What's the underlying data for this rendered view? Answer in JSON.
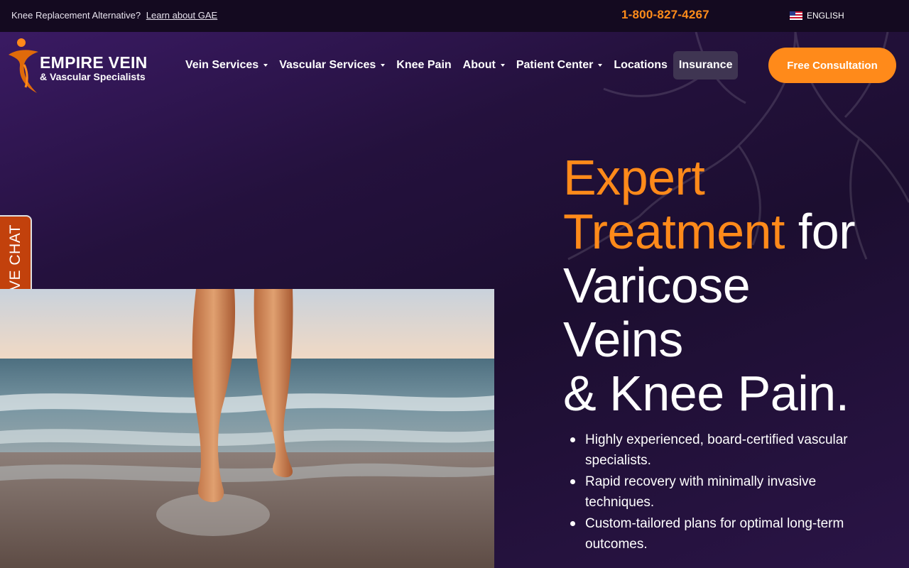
{
  "topbar": {
    "announce_text": "Knee Replacement Alternative?",
    "announce_link": "Learn about GAE",
    "phone": "1-800-827-4267",
    "language": "ENGLISH"
  },
  "logo": {
    "main": "EMPIRE VEIN",
    "sub": "& Vascular Specialists"
  },
  "nav": {
    "items": [
      {
        "label": "Vein Services",
        "dropdown": true
      },
      {
        "label": "Vascular Services",
        "dropdown": true
      },
      {
        "label": "Knee Pain",
        "dropdown": false
      },
      {
        "label": "About",
        "dropdown": true
      },
      {
        "label": "Patient Center",
        "dropdown": true
      },
      {
        "label": "Locations",
        "dropdown": false
      },
      {
        "label": "Insurance",
        "dropdown": false
      }
    ],
    "cta": "Free Consultation"
  },
  "livechat": {
    "label": "LIVE CHAT"
  },
  "hero": {
    "line1_orange": "Expert",
    "line2_orange": "Treatment",
    "line2_white": " for",
    "line3": "Varicose",
    "line4": "Veins",
    "line5": "& Knee Pain.",
    "bullets": [
      "Highly experienced, board-certified vascular specialists.",
      "Rapid recovery with minimally invasive techniques.",
      "Custom-tailored plans for optimal long-term outcomes."
    ]
  },
  "colors": {
    "accent": "#ff8a1a",
    "background": "#1d0f33",
    "livechat": "#c2410c"
  }
}
